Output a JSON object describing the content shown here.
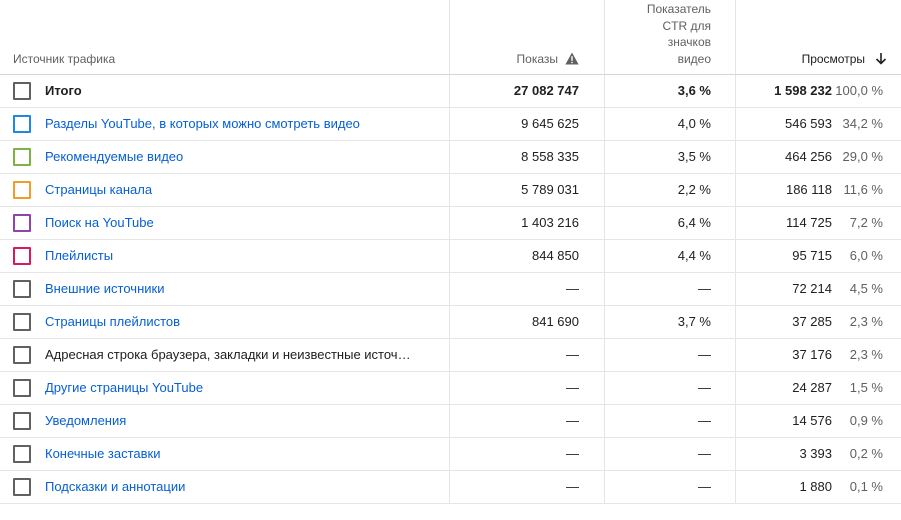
{
  "header": {
    "source": "Источник трафика",
    "impressions": "Показы",
    "ctr_lines": [
      "Показатель",
      "CTR для",
      "значков",
      "видео"
    ],
    "views": "Просмотры"
  },
  "rows": [
    {
      "name": "Итого",
      "impressions": "27 082 747",
      "ctr": "3,6 %",
      "views": "1 598 232",
      "pct": "100,0 %",
      "color": "#616161",
      "kind": "total"
    },
    {
      "name": "Разделы YouTube, в которых можно смотреть видео",
      "impressions": "9 645 625",
      "ctr": "4,0 %",
      "views": "546 593",
      "pct": "34,2 %",
      "color": "#1e88e5",
      "kind": "link"
    },
    {
      "name": "Рекомендуемые видео",
      "impressions": "8 558 335",
      "ctr": "3,5 %",
      "views": "464 256",
      "pct": "29,0 %",
      "color": "#7cb342",
      "kind": "link"
    },
    {
      "name": "Страницы канала",
      "impressions": "5 789 031",
      "ctr": "2,2 %",
      "views": "186 118",
      "pct": "11,6 %",
      "color": "#f29c2b",
      "kind": "link"
    },
    {
      "name": "Поиск на YouTube",
      "impressions": "1 403 216",
      "ctr": "6,4 %",
      "views": "114 725",
      "pct": "7,2 %",
      "color": "#8e44ad",
      "kind": "link"
    },
    {
      "name": "Плейлисты",
      "impressions": "844 850",
      "ctr": "4,4 %",
      "views": "95 715",
      "pct": "6,0 %",
      "color": "#d81b60",
      "kind": "link"
    },
    {
      "name": "Внешние источники",
      "impressions": "—",
      "ctr": "—",
      "views": "72 214",
      "pct": "4,5 %",
      "color": "#616161",
      "kind": "link"
    },
    {
      "name": "Страницы плейлистов",
      "impressions": "841 690",
      "ctr": "3,7 %",
      "views": "37 285",
      "pct": "2,3 %",
      "color": "#616161",
      "kind": "link"
    },
    {
      "name": "Адресная строка браузера, закладки и неизвестные источ…",
      "impressions": "—",
      "ctr": "—",
      "views": "37 176",
      "pct": "2,3 %",
      "color": "#616161",
      "kind": "plain"
    },
    {
      "name": "Другие страницы YouTube",
      "impressions": "—",
      "ctr": "—",
      "views": "24 287",
      "pct": "1,5 %",
      "color": "#616161",
      "kind": "link"
    },
    {
      "name": "Уведомления",
      "impressions": "—",
      "ctr": "—",
      "views": "14 576",
      "pct": "0,9 %",
      "color": "#616161",
      "kind": "link"
    },
    {
      "name": "Конечные заставки",
      "impressions": "—",
      "ctr": "—",
      "views": "3 393",
      "pct": "0,2 %",
      "color": "#616161",
      "kind": "link"
    },
    {
      "name": "Подсказки и аннотации",
      "impressions": "—",
      "ctr": "—",
      "views": "1 880",
      "pct": "0,1 %",
      "color": "#616161",
      "kind": "link"
    }
  ]
}
